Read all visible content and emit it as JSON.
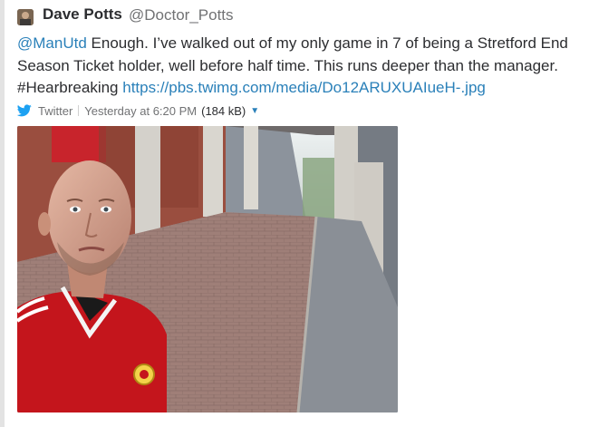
{
  "tweet": {
    "author_name": "Dave Potts",
    "author_handle": "@Doctor_Potts",
    "mention": "@ManUtd",
    "text_line1_rest": " Enough. I’ve walked out of my only game in 7 of being a Stretford End",
    "text_line2": "Season Ticket holder, well before half time. This runs deeper than the manager.",
    "hashtag": "#Hearbreaking",
    "link": "https://pbs.twimg.com/media/Do12ARUXUAIueH-.jpg"
  },
  "meta": {
    "service_icon": "twitter-bird-icon",
    "service_name": "Twitter",
    "timestamp": "Yesterday at 6:20 PM",
    "file_size": "(184 kB)",
    "dropdown_icon": "caret-down-icon"
  },
  "colors": {
    "link": "#2a80b9",
    "twitter_blue": "#1da1f2",
    "text": "#2c2d30",
    "muted": "#717274"
  },
  "image": {
    "description_icon": "photo-selfie-image",
    "crest_text": "MANCHESTER UNITED"
  }
}
